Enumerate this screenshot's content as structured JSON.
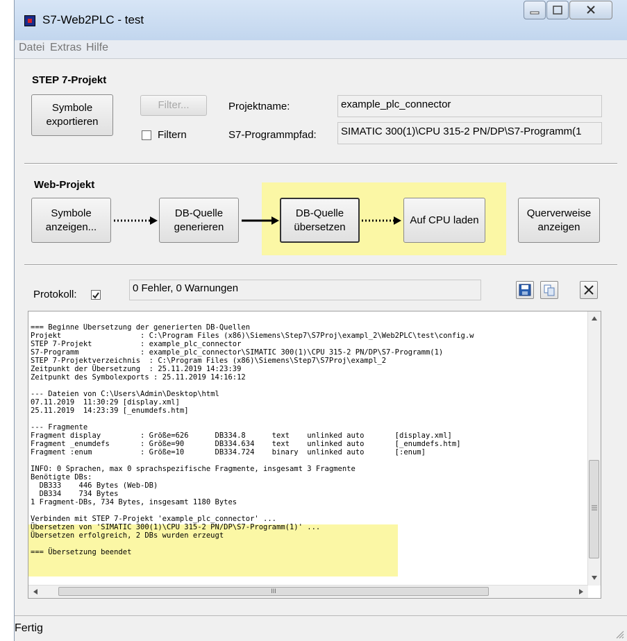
{
  "window": {
    "title": "S7-Web2PLC - test"
  },
  "menu": [
    "Datei",
    "Extras",
    "Hilfe"
  ],
  "step7": {
    "title": "STEP 7-Projekt",
    "export_button": "Symbole\nexportieren",
    "filter_button": "Filter...",
    "filter_checkbox_label": "Filtern",
    "projektname_label": "Projektname:",
    "projektname_value": "example_plc_connector",
    "programmpfad_label": "S7-Programmpfad:",
    "programmpfad_value": "SIMATIC 300(1)\\CPU 315-2 PN/DP\\S7-Programm(1"
  },
  "web": {
    "title": "Web-Projekt",
    "btn_symbole": "Symbole\nanzeigen...",
    "btn_db_gen": "DB-Quelle\ngenerieren",
    "btn_db_uebersetzen": "DB-Quelle\nübersetzen",
    "btn_cpu_laden": "Auf CPU laden",
    "btn_querverweise": "Querverweise\nanzeigen"
  },
  "protokoll": {
    "label": "Protokoll:",
    "checked": true,
    "status": "0 Fehler, 0 Warnungen",
    "log_lines": [
      "=== Beginne Übersetzung der generierten DB-Quellen",
      "Projekt                  : C:\\Program Files (x86)\\Siemens\\Step7\\S7Proj\\exampl_2\\Web2PLC\\test\\config.w",
      "STEP 7-Projekt           : example_plc_connector",
      "S7-Programm              : example_plc_connector\\SIMATIC 300(1)\\CPU 315-2 PN/DP\\S7-Programm(1)",
      "STEP 7-Projektverzeichnis  : C:\\Program Files (x86)\\Siemens\\Step7\\S7Proj\\exampl_2",
      "Zeitpunkt der Übersetzung  : 25.11.2019 14:23:39",
      "Zeitpunkt des Symbolexports : 25.11.2019 14:16:12",
      "",
      "--- Dateien von C:\\Users\\Admin\\Desktop\\html",
      "07.11.2019  11:30:29 [display.xml]",
      "25.11.2019  14:23:39 [_enumdefs.htm]",
      "",
      "--- Fragmente",
      "Fragment display         : Größe=626      DB334.8      text    unlinked auto       [display.xml]",
      "Fragment _enumdefs       : Größe=90       DB334.634    text    unlinked auto       [_enumdefs.htm]",
      "Fragment :enum           : Größe=10       DB334.724    binary  unlinked auto       [:enum]",
      "",
      "INFO: 0 Sprachen, max 0 sprachspezifische Fragmente, insgesamt 3 Fragmente",
      "Benötigte DBs:",
      "  DB333    446 Bytes (Web-DB)",
      "  DB334    734 Bytes",
      "1 Fragment-DBs, 734 Bytes, insgesamt 1180 Bytes",
      "",
      "Verbinden mit STEP 7-Projekt 'example_plc_connector' ...",
      "Übersetzen von 'SIMATIC 300(1)\\CPU 315-2 PN/DP\\S7-Programm(1)' ...",
      "Übersetzen erfolgreich, 2 DBs wurden erzeugt",
      "",
      "=== Übersetzung beendet"
    ],
    "hscroll_mark": "III"
  },
  "statusbar": {
    "text": "Fertig"
  },
  "colors": {
    "highlight": "#fbf7a5"
  }
}
